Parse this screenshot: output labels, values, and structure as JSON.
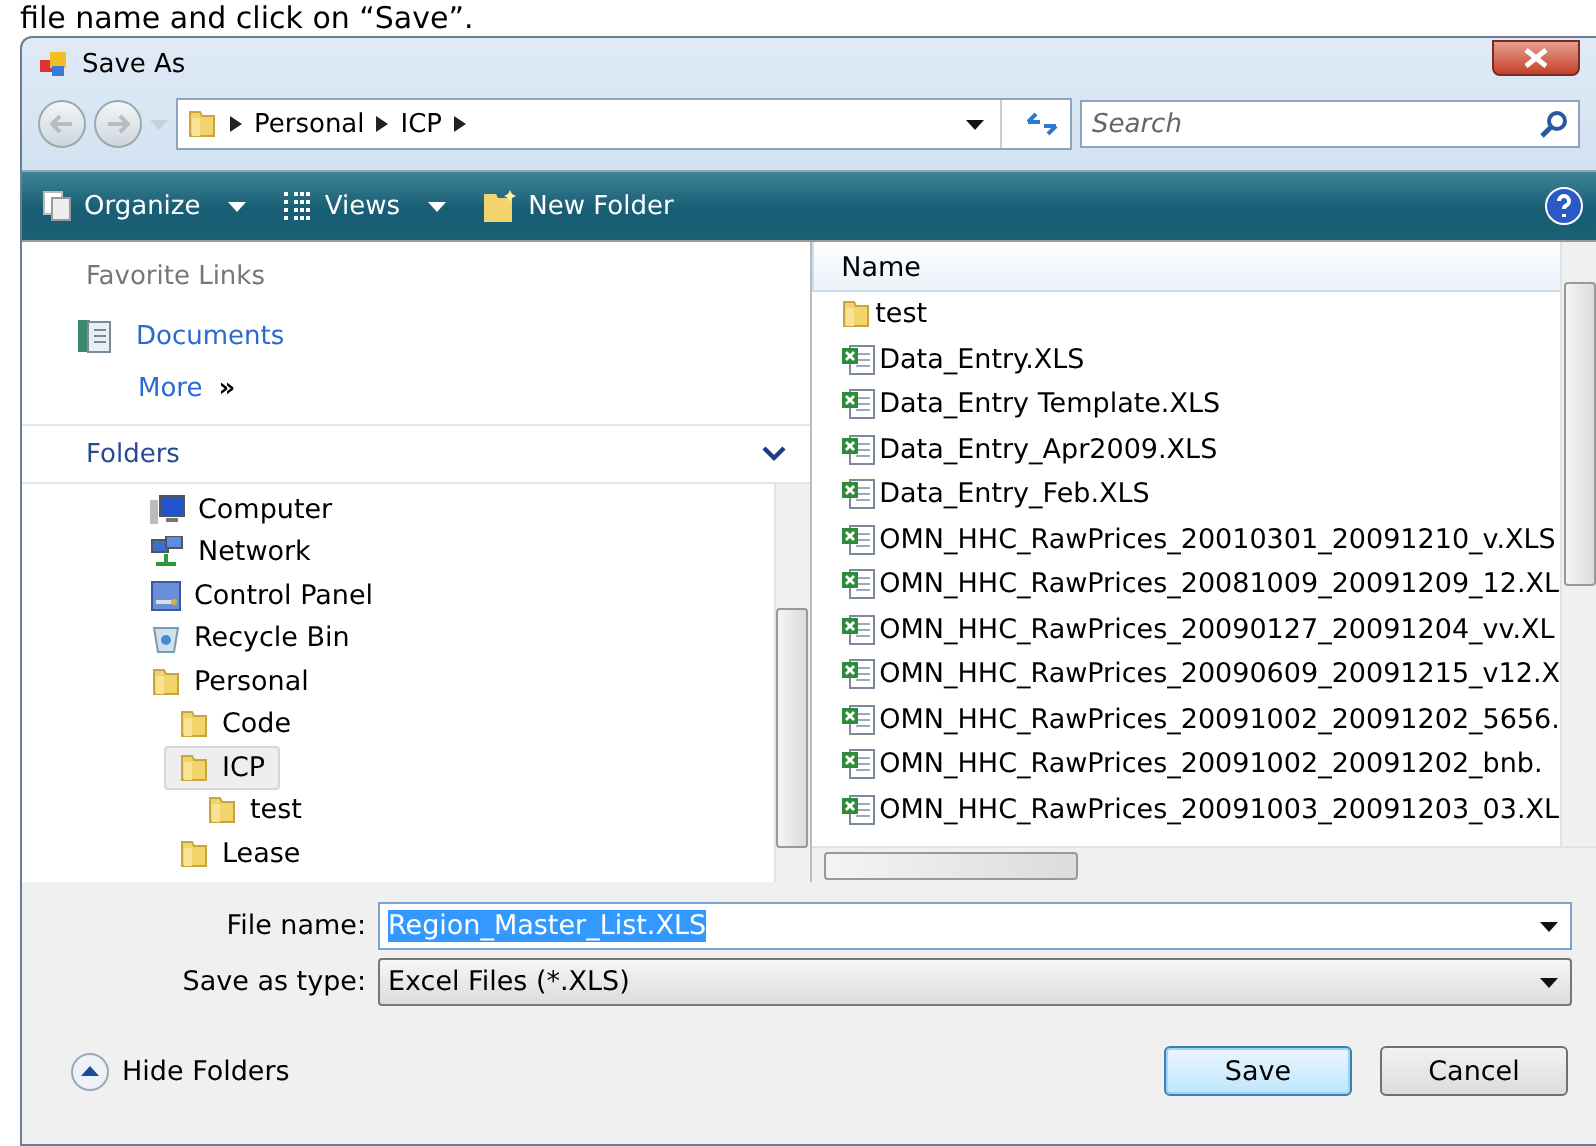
{
  "caption": "file name and click on “Save”.",
  "window": {
    "title": "Save As"
  },
  "address_bar": {
    "breadcrumbs": [
      "Personal",
      "ICP"
    ]
  },
  "search": {
    "placeholder": "Search"
  },
  "toolbar": {
    "items": [
      {
        "label": "Organize",
        "kind": "organize"
      },
      {
        "label": "Views",
        "kind": "views"
      },
      {
        "label": "New Folder",
        "kind": "new-folder"
      }
    ]
  },
  "favorite_links": {
    "heading": "Favorite Links",
    "items": [
      {
        "label": "Documents",
        "kind": "documents"
      }
    ],
    "more": {
      "label": "More",
      "glyph": "»"
    }
  },
  "folders": {
    "heading": "Folders",
    "tree": [
      {
        "label": "Computer",
        "kind": "computer",
        "selected": false
      },
      {
        "label": "Network",
        "kind": "network",
        "selected": false
      },
      {
        "label": "Control Panel",
        "kind": "control-panel",
        "selected": false
      },
      {
        "label": "Recycle Bin",
        "kind": "recycle-bin",
        "selected": false
      },
      {
        "label": "Personal",
        "kind": "folder",
        "selected": false,
        "children": [
          {
            "label": "Code",
            "kind": "folder",
            "selected": false
          },
          {
            "label": "ICP",
            "kind": "folder",
            "selected": true,
            "children": [
              {
                "label": "test",
                "kind": "folder",
                "selected": false
              }
            ]
          },
          {
            "label": "Lease",
            "kind": "folder",
            "selected": false
          }
        ]
      }
    ]
  },
  "file_list": {
    "column": "Name",
    "files": [
      {
        "name": "test",
        "kind": "folder"
      },
      {
        "name": "Data_Entry.XLS",
        "kind": "excel"
      },
      {
        "name": "Data_Entry Template.XLS",
        "kind": "excel"
      },
      {
        "name": "Data_Entry_Apr2009.XLS",
        "kind": "excel"
      },
      {
        "name": "Data_Entry_Feb.XLS",
        "kind": "excel"
      },
      {
        "name": "OMN_HHC_RawPrices_20010301_20091210_v.XLS",
        "kind": "excel"
      },
      {
        "name": "OMN_HHC_RawPrices_20081009_20091209_12.XL",
        "kind": "excel"
      },
      {
        "name": "OMN_HHC_RawPrices_20090127_20091204_vv.XL",
        "kind": "excel"
      },
      {
        "name": "OMN_HHC_RawPrices_20090609_20091215_v12.X",
        "kind": "excel"
      },
      {
        "name": "OMN_HHC_RawPrices_20091002_20091202_5656.",
        "kind": "excel"
      },
      {
        "name": "OMN_HHC_RawPrices_20091002_20091202_bnb.",
        "kind": "excel"
      },
      {
        "name": "OMN_HHC_RawPrices_20091003_20091203_03.XL",
        "kind": "excel"
      }
    ]
  },
  "file_name": {
    "label": "File name:",
    "value": "Region_Master_List.XLS",
    "text_selected": true
  },
  "save_as_type": {
    "label": "Save as type:",
    "value": "Excel Files (*.XLS)"
  },
  "hide_folders": {
    "label": "Hide Folders"
  },
  "buttons": [
    {
      "label": "Save",
      "default": true
    },
    {
      "label": "Cancel",
      "default": false
    }
  ]
}
